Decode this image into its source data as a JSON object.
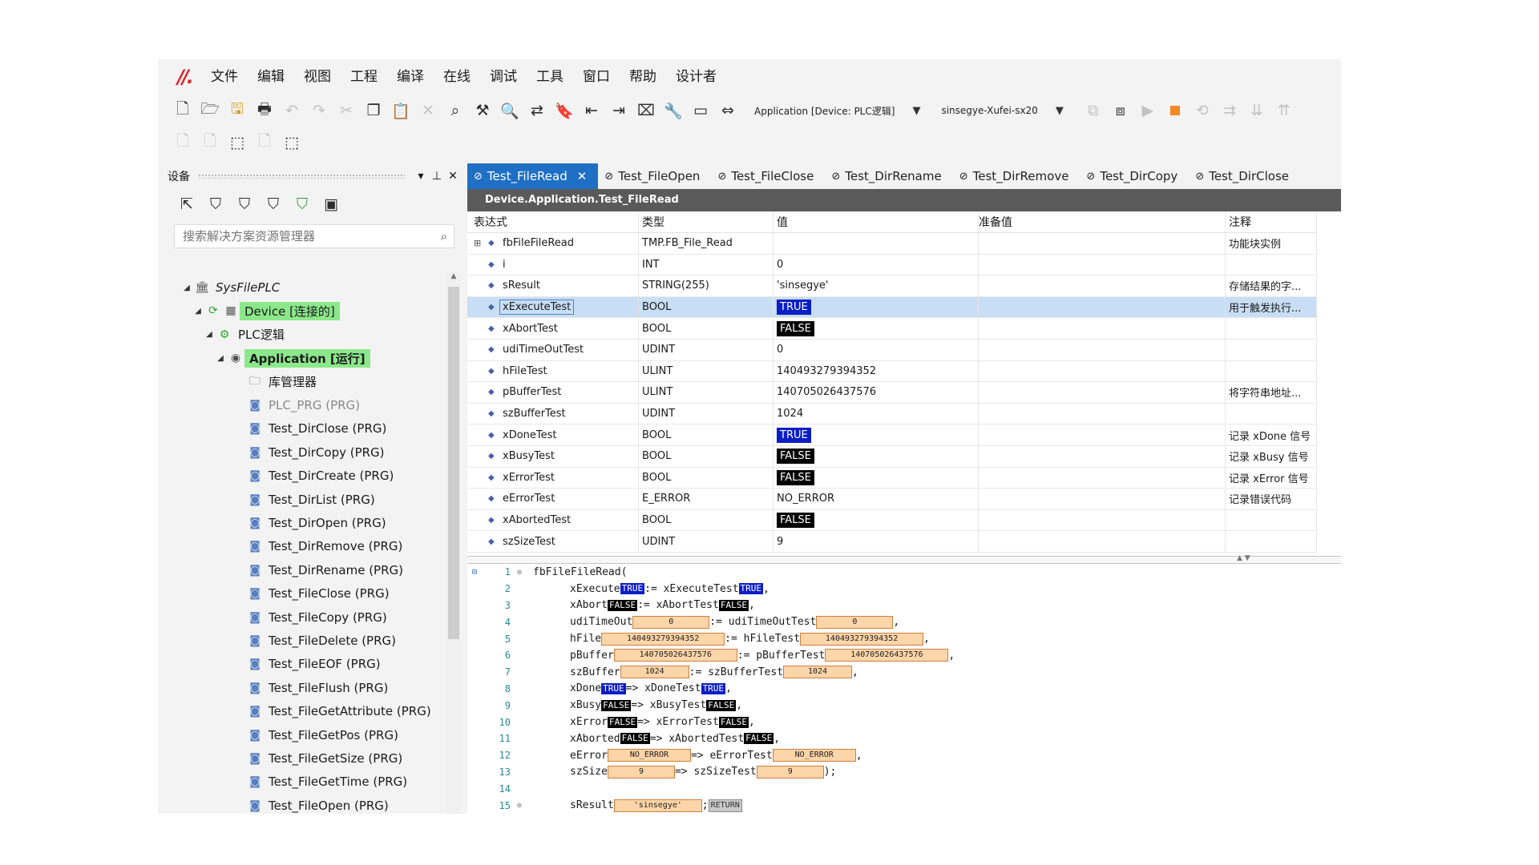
{
  "menu": [
    "文件",
    "编辑",
    "视图",
    "工程",
    "编译",
    "在线",
    "调试",
    "工具",
    "窗口",
    "帮助",
    "设计者"
  ],
  "toolbar": {
    "app_selector": "Application [Device: PLC逻辑]",
    "device_selector": "sinsegye-Xufei-sx20"
  },
  "left_panel": {
    "title": "设备",
    "search_placeholder": "搜索解决方案资源管理器",
    "tree": [
      {
        "label": "SysFilePLC",
        "level": 0,
        "icon": "project-icon",
        "expand": "▲"
      },
      {
        "label": "Device [连接的]",
        "level": 1,
        "icon": "device-icon",
        "expand": "▲",
        "highlight": true
      },
      {
        "label": "PLC逻辑",
        "level": 2,
        "icon": "plc-logic-icon",
        "expand": "▲"
      },
      {
        "label": "Application [运行]",
        "level": 3,
        "icon": "application-icon",
        "expand": "▲",
        "highlight": true,
        "bold": true
      },
      {
        "label": "库管理器",
        "level": 4,
        "icon": "library-icon"
      },
      {
        "label": "PLC_PRG (PRG)",
        "level": 4,
        "icon": "prg-icon",
        "gray": true
      },
      {
        "label": "Test_DirClose (PRG)",
        "level": 4,
        "icon": "prg-icon"
      },
      {
        "label": "Test_DirCopy (PRG)",
        "level": 4,
        "icon": "prg-icon"
      },
      {
        "label": "Test_DirCreate (PRG)",
        "level": 4,
        "icon": "prg-icon"
      },
      {
        "label": "Test_DirList (PRG)",
        "level": 4,
        "icon": "prg-icon"
      },
      {
        "label": "Test_DirOpen (PRG)",
        "level": 4,
        "icon": "prg-icon"
      },
      {
        "label": "Test_DirRemove (PRG)",
        "level": 4,
        "icon": "prg-icon"
      },
      {
        "label": "Test_DirRename (PRG)",
        "level": 4,
        "icon": "prg-icon"
      },
      {
        "label": "Test_FileClose (PRG)",
        "level": 4,
        "icon": "prg-icon"
      },
      {
        "label": "Test_FileCopy (PRG)",
        "level": 4,
        "icon": "prg-icon"
      },
      {
        "label": "Test_FileDelete (PRG)",
        "level": 4,
        "icon": "prg-icon"
      },
      {
        "label": "Test_FileEOF (PRG)",
        "level": 4,
        "icon": "prg-icon"
      },
      {
        "label": "Test_FileFlush (PRG)",
        "level": 4,
        "icon": "prg-icon"
      },
      {
        "label": "Test_FileGetAttribute (PRG)",
        "level": 4,
        "icon": "prg-icon"
      },
      {
        "label": "Test_FileGetPos (PRG)",
        "level": 4,
        "icon": "prg-icon"
      },
      {
        "label": "Test_FileGetSize (PRG)",
        "level": 4,
        "icon": "prg-icon"
      },
      {
        "label": "Test_FileGetTime (PRG)",
        "level": 4,
        "icon": "prg-icon"
      },
      {
        "label": "Test_FileOpen (PRG)",
        "level": 4,
        "icon": "prg-icon"
      }
    ]
  },
  "tabs": [
    {
      "label": "Test_FileRead",
      "active": true
    },
    {
      "label": "Test_FileOpen"
    },
    {
      "label": "Test_FileClose"
    },
    {
      "label": "Test_DirRename"
    },
    {
      "label": "Test_DirRemove"
    },
    {
      "label": "Test_DirCopy"
    },
    {
      "label": "Test_DirClose"
    }
  ],
  "breadcrumb": "Device.Application.Test_FileRead",
  "watch": {
    "headers": [
      "表达式",
      "类型",
      "值",
      "准备值",
      "注释"
    ],
    "rows": [
      {
        "expr": "fbFileFileRead",
        "type": "TMP.FB_File_Read",
        "value": "",
        "kind": "text",
        "comment": "功能块实例",
        "expandable": true
      },
      {
        "expr": "i",
        "type": "INT",
        "value": "0",
        "kind": "text",
        "comment": ""
      },
      {
        "expr": "sResult",
        "type": "STRING(255)",
        "value": "'sinsegye'",
        "kind": "text",
        "comment": "存储结果的字..."
      },
      {
        "expr": "xExecuteTest",
        "type": "BOOL",
        "value": "TRUE",
        "kind": "true",
        "comment": "用于触发执行...",
        "selected": true
      },
      {
        "expr": "xAbortTest",
        "type": "BOOL",
        "value": "FALSE",
        "kind": "false",
        "comment": ""
      },
      {
        "expr": "udiTimeOutTest",
        "type": "UDINT",
        "value": "0",
        "kind": "text",
        "comment": ""
      },
      {
        "expr": "hFileTest",
        "type": "ULINT",
        "value": "140493279394352",
        "kind": "text",
        "comment": ""
      },
      {
        "expr": "pBufferTest",
        "type": "ULINT",
        "value": "140705026437576",
        "kind": "text",
        "comment": "将字符串地址..."
      },
      {
        "expr": "szBufferTest",
        "type": "UDINT",
        "value": "1024",
        "kind": "text",
        "comment": ""
      },
      {
        "expr": "xDoneTest",
        "type": "BOOL",
        "value": "TRUE",
        "kind": "true",
        "comment": "记录 xDone 信号"
      },
      {
        "expr": "xBusyTest",
        "type": "BOOL",
        "value": "FALSE",
        "kind": "false",
        "comment": "记录 xBusy 信号"
      },
      {
        "expr": "xErrorTest",
        "type": "BOOL",
        "value": "FALSE",
        "kind": "false",
        "comment": "记录 xError 信号"
      },
      {
        "expr": "eErrorTest",
        "type": "E_ERROR",
        "value": "NO_ERROR",
        "kind": "text",
        "comment": "记录错误代码"
      },
      {
        "expr": "xAbortedTest",
        "type": "BOOL",
        "value": "FALSE",
        "kind": "false",
        "comment": ""
      },
      {
        "expr": "szSizeTest",
        "type": "UDINT",
        "value": "9",
        "kind": "text",
        "comment": ""
      }
    ]
  },
  "code": [
    {
      "n": "1",
      "fold": "⊟",
      "bp": true,
      "indent": 0,
      "parts": [
        {
          "t": "fbFileFileRead("
        }
      ]
    },
    {
      "n": "2",
      "indent": 1,
      "parts": [
        {
          "t": "xExecute"
        },
        {
          "b": "TRUE"
        },
        {
          "t": ":= xExecuteTest"
        },
        {
          "b": "TRUE"
        },
        {
          "t": ","
        }
      ]
    },
    {
      "n": "3",
      "indent": 1,
      "parts": [
        {
          "t": "xAbort"
        },
        {
          "b": "FALSE"
        },
        {
          "t": ":= xAbortTest"
        },
        {
          "b": "FALSE"
        },
        {
          "t": ","
        }
      ]
    },
    {
      "n": "4",
      "indent": 1,
      "parts": [
        {
          "t": "udiTimeOut"
        },
        {
          "v": "0",
          "w": 90
        },
        {
          "t": ":= udiTimeOutTest"
        },
        {
          "v": "0",
          "w": 90
        },
        {
          "t": ","
        }
      ]
    },
    {
      "n": "5",
      "indent": 1,
      "parts": [
        {
          "t": "hFile"
        },
        {
          "v": "140493279394352",
          "w": 148
        },
        {
          "t": ":= hFileTest"
        },
        {
          "v": "140493279394352",
          "w": 148
        },
        {
          "t": ","
        }
      ]
    },
    {
      "n": "6",
      "indent": 1,
      "parts": [
        {
          "t": "pBuffer"
        },
        {
          "v": "140705026437576",
          "w": 148
        },
        {
          "t": ":= pBufferTest"
        },
        {
          "v": "140705026437576",
          "w": 148
        },
        {
          "t": ","
        }
      ]
    },
    {
      "n": "7",
      "indent": 1,
      "parts": [
        {
          "t": "szBuffer"
        },
        {
          "v": "1024",
          "w": 80
        },
        {
          "t": ":= szBufferTest"
        },
        {
          "v": "1024",
          "w": 80
        },
        {
          "t": ","
        }
      ]
    },
    {
      "n": "8",
      "indent": 1,
      "parts": [
        {
          "t": "xDone"
        },
        {
          "b": "TRUE"
        },
        {
          "t": "=> xDoneTest"
        },
        {
          "b": "TRUE"
        },
        {
          "t": ","
        }
      ]
    },
    {
      "n": "9",
      "indent": 1,
      "parts": [
        {
          "t": "xBusy"
        },
        {
          "b": "FALSE"
        },
        {
          "t": "=> xBusyTest"
        },
        {
          "b": "FALSE"
        },
        {
          "t": ","
        }
      ]
    },
    {
      "n": "10",
      "indent": 1,
      "parts": [
        {
          "t": "xError"
        },
        {
          "b": "FALSE"
        },
        {
          "t": "=> xErrorTest"
        },
        {
          "b": "FALSE"
        },
        {
          "t": ","
        }
      ]
    },
    {
      "n": "11",
      "indent": 1,
      "parts": [
        {
          "t": "xAborted"
        },
        {
          "b": "FALSE"
        },
        {
          "t": "=> xAbortedTest"
        },
        {
          "b": "FALSE"
        },
        {
          "t": ","
        }
      ]
    },
    {
      "n": "12",
      "indent": 1,
      "parts": [
        {
          "t": "eError"
        },
        {
          "v": "NO_ERROR",
          "w": 98
        },
        {
          "t": "=> eErrorTest"
        },
        {
          "v": "NO_ERROR",
          "w": 98
        },
        {
          "t": ","
        }
      ]
    },
    {
      "n": "13",
      "indent": 1,
      "parts": [
        {
          "t": "szSize"
        },
        {
          "v": "9",
          "w": 78
        },
        {
          "t": "=> szSizeTest"
        },
        {
          "v": "9",
          "w": 78
        },
        {
          "t": ");"
        }
      ]
    },
    {
      "n": "14",
      "indent": 0,
      "parts": []
    },
    {
      "n": "15",
      "bp": true,
      "indent": 1,
      "parts": [
        {
          "t": "sResult"
        },
        {
          "v": "'sinsegye'",
          "w": 104
        },
        {
          "t": ";"
        },
        {
          "r": "RETURN"
        }
      ]
    }
  ]
}
